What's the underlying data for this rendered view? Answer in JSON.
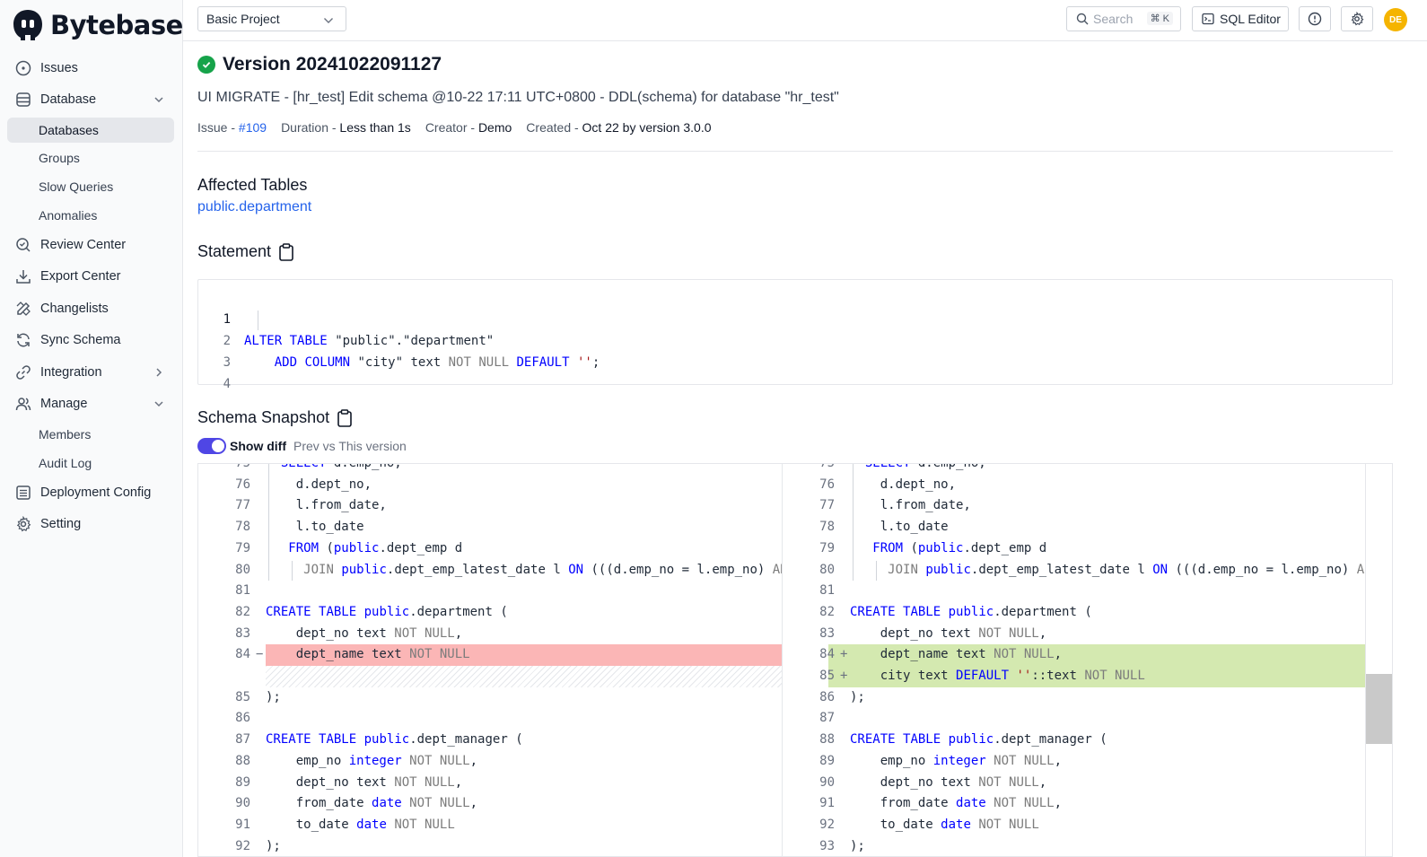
{
  "app": {
    "name": "Bytebase"
  },
  "sidebar": {
    "items": [
      {
        "label": "Issues"
      },
      {
        "label": "Database"
      },
      {
        "label": "Databases"
      },
      {
        "label": "Groups"
      },
      {
        "label": "Slow Queries"
      },
      {
        "label": "Anomalies"
      },
      {
        "label": "Review Center"
      },
      {
        "label": "Export Center"
      },
      {
        "label": "Changelists"
      },
      {
        "label": "Sync Schema"
      },
      {
        "label": "Integration"
      },
      {
        "label": "Manage"
      },
      {
        "label": "Members"
      },
      {
        "label": "Audit Log"
      },
      {
        "label": "Deployment Config"
      },
      {
        "label": "Setting"
      }
    ]
  },
  "topbar": {
    "project": "Basic Project",
    "search_placeholder": "Search",
    "search_shortcut": "⌘ K",
    "sql_editor_label": "SQL Editor",
    "avatar_initials": "DE"
  },
  "page": {
    "title": "Version 20241022091127",
    "description": "UI MIGRATE - [hr_test] Edit schema @10-22 17:11 UTC+0800 - DDL(schema) for database \"hr_test\"",
    "meta": {
      "issue_label": "Issue - ",
      "issue_value": "#109",
      "duration_label": "Duration - ",
      "duration_value": "Less than 1s",
      "creator_label": "Creator - ",
      "creator_value": "Demo",
      "created_label": "Created - ",
      "created_value": "Oct 22 by version 3.0.0"
    },
    "affected_tables_title": "Affected Tables",
    "affected_tables": [
      "public.department"
    ],
    "statement_title": "Statement",
    "statement_line_numbers": [
      "1",
      "2",
      "3",
      "4"
    ],
    "schema_snapshot_title": "Schema Snapshot",
    "show_diff_label": "Show diff",
    "show_diff_enabled": true,
    "diff_subtitle": "Prev vs This version"
  },
  "diff": {
    "left_line_numbers": [
      "75",
      "76",
      "77",
      "78",
      "79",
      "80",
      "81",
      "82",
      "83",
      "84",
      "",
      "85",
      "86",
      "87",
      "88",
      "89",
      "90",
      "91",
      "92"
    ],
    "right_line_numbers": [
      "75",
      "76",
      "77",
      "78",
      "79",
      "80",
      "81",
      "82",
      "83",
      "84",
      "85",
      "86",
      "87",
      "88",
      "89",
      "90",
      "91",
      "92",
      "93"
    ],
    "removed_marker": "−",
    "added_marker": "+"
  },
  "colors": {
    "accent": "#4f46e5",
    "success": "#16a34a",
    "link": "#2563eb",
    "removed_bg": "#fbb6b6",
    "added_bg": "#d4e9b0"
  },
  "icons": {
    "issues": "circle-dot-icon",
    "database": "database-icon",
    "review_center": "search-check-icon",
    "export_center": "download-icon",
    "changelists": "pencil-ruler-icon",
    "sync_schema": "refresh-icon",
    "integration": "link-icon",
    "manage": "users-icon",
    "deployment_config": "list-icon",
    "setting": "gear-icon"
  }
}
